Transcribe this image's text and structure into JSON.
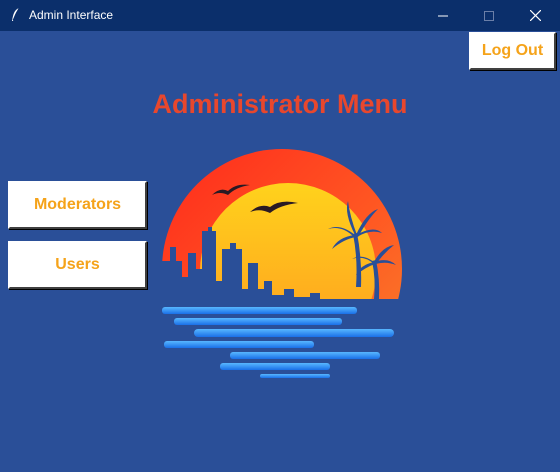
{
  "window": {
    "title": "Admin Interface",
    "app_icon": "feather-icon",
    "controls": [
      "minimize-icon",
      "maximize-icon",
      "close-icon"
    ]
  },
  "header": {
    "title": "Administrator Menu",
    "logout_label": "Log Out"
  },
  "menu": {
    "moderators_label": "Moderators",
    "users_label": "Users"
  },
  "logo": {
    "description": "sunset-city-logo"
  },
  "colors": {
    "background": "#2a4f98",
    "titlebar": "#0b2f6b",
    "heading": "#e8472d",
    "button_text": "#f5a31a",
    "button_bg": "#ffffff"
  }
}
